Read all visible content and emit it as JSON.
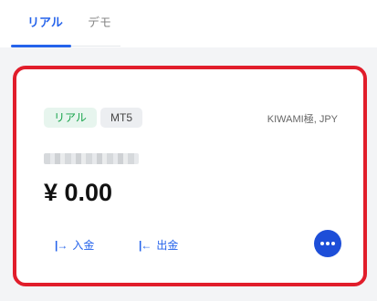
{
  "tabs": [
    {
      "label": "リアル",
      "active": true
    },
    {
      "label": "デモ",
      "active": false
    }
  ],
  "account": {
    "badges": [
      "リアル",
      "MT5"
    ],
    "type": "KIWAMI極, JPY",
    "balance": "¥ 0.00"
  },
  "actions": {
    "deposit": {
      "icon": "|→",
      "label": "入金"
    },
    "withdraw": {
      "icon": "|←",
      "label": "出金"
    }
  },
  "more_icon": "more-dots",
  "colors": {
    "accent": "#2563eb",
    "highlight_border": "#e11d2b",
    "badge_real_bg": "#e7f5ee",
    "badge_real_text": "#16a34a"
  }
}
